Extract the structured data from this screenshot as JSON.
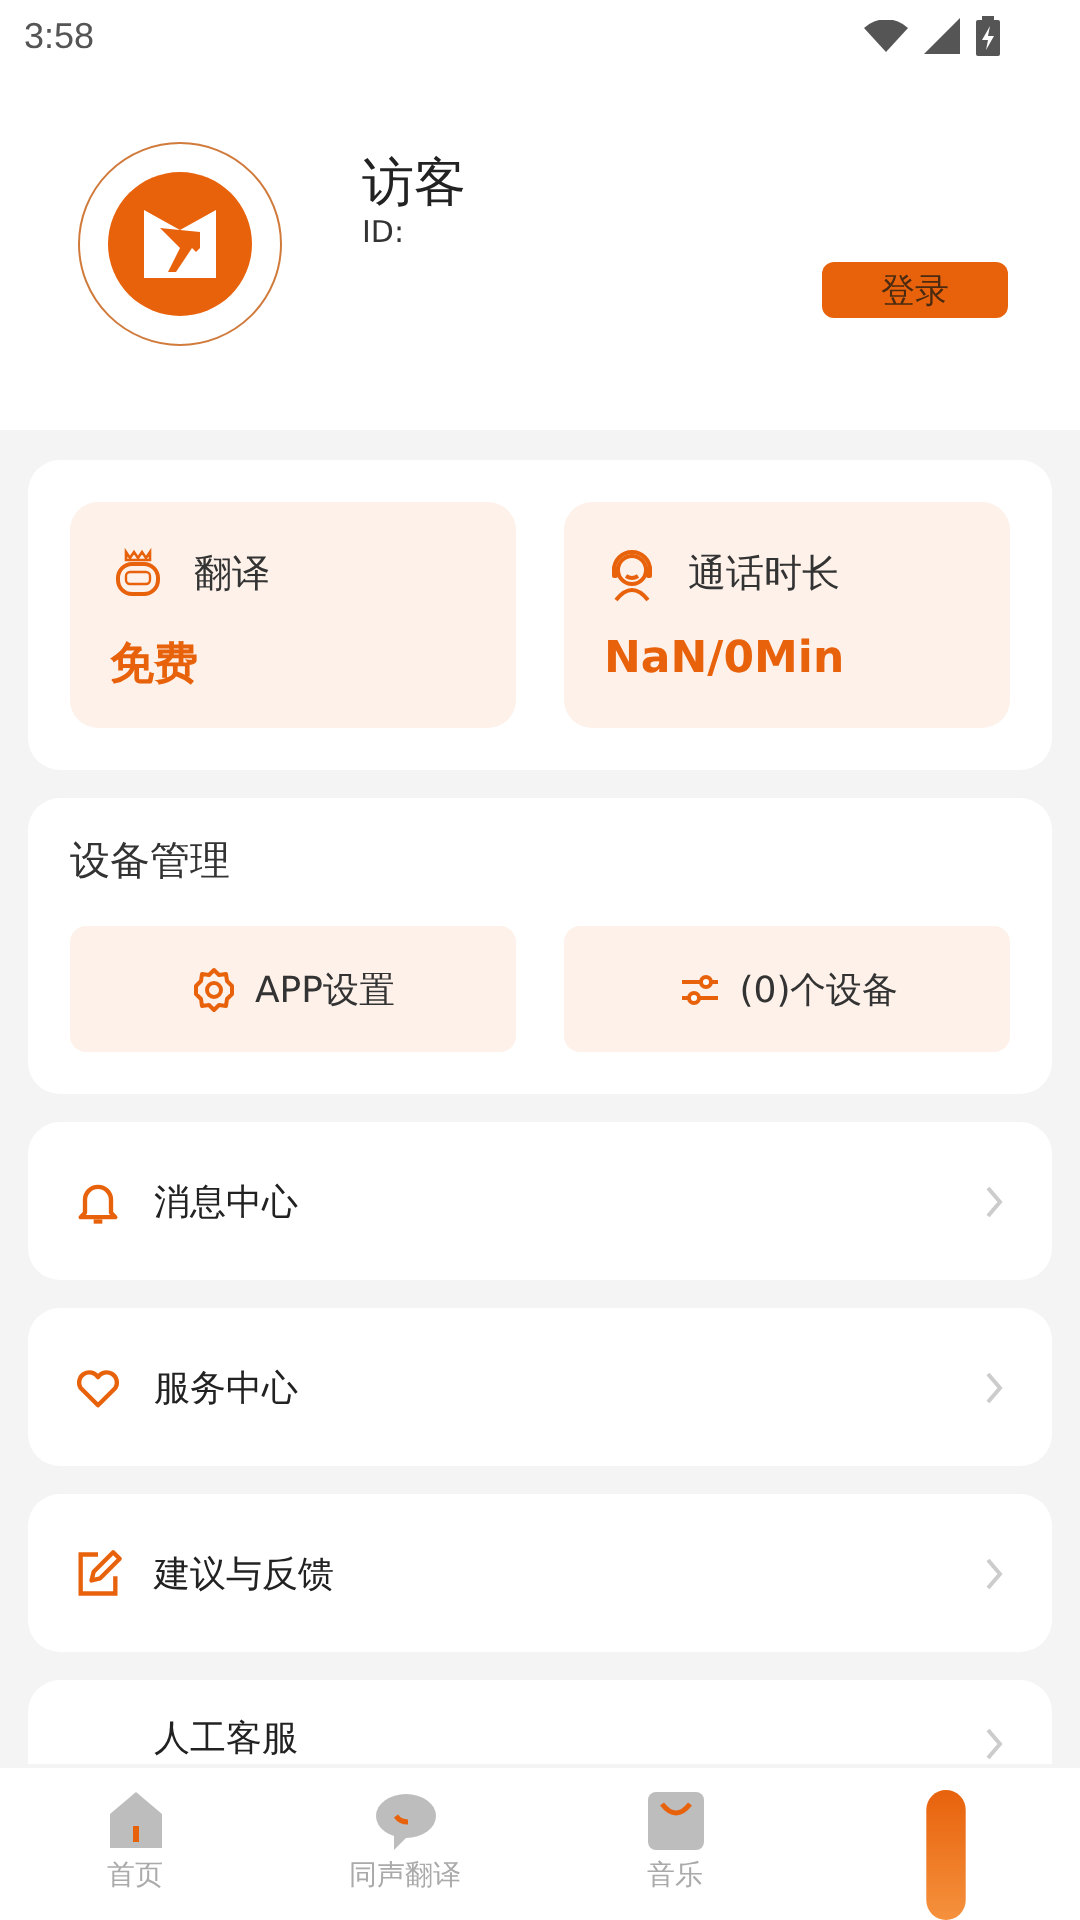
{
  "status_bar": {
    "time": "3:58"
  },
  "profile": {
    "name": "访客",
    "id_label": "ID:",
    "login_button": "登录"
  },
  "stats": [
    {
      "label": "翻译",
      "value": "免费"
    },
    {
      "label": "通话时长",
      "value": "NaN/0Min"
    }
  ],
  "devices": {
    "title": "设备管理",
    "buttons": [
      {
        "label": "APP设置"
      },
      {
        "label": "(0)个设备"
      }
    ]
  },
  "menu": [
    {
      "label": "消息中心"
    },
    {
      "label": "服务中心"
    },
    {
      "label": "建议与反馈"
    },
    {
      "label": "人工客服"
    }
  ],
  "bottom_nav": [
    {
      "label": "首页",
      "selected": false
    },
    {
      "label": "同声翻译",
      "selected": false
    },
    {
      "label": "音乐",
      "selected": false
    },
    {
      "selected": true
    }
  ]
}
